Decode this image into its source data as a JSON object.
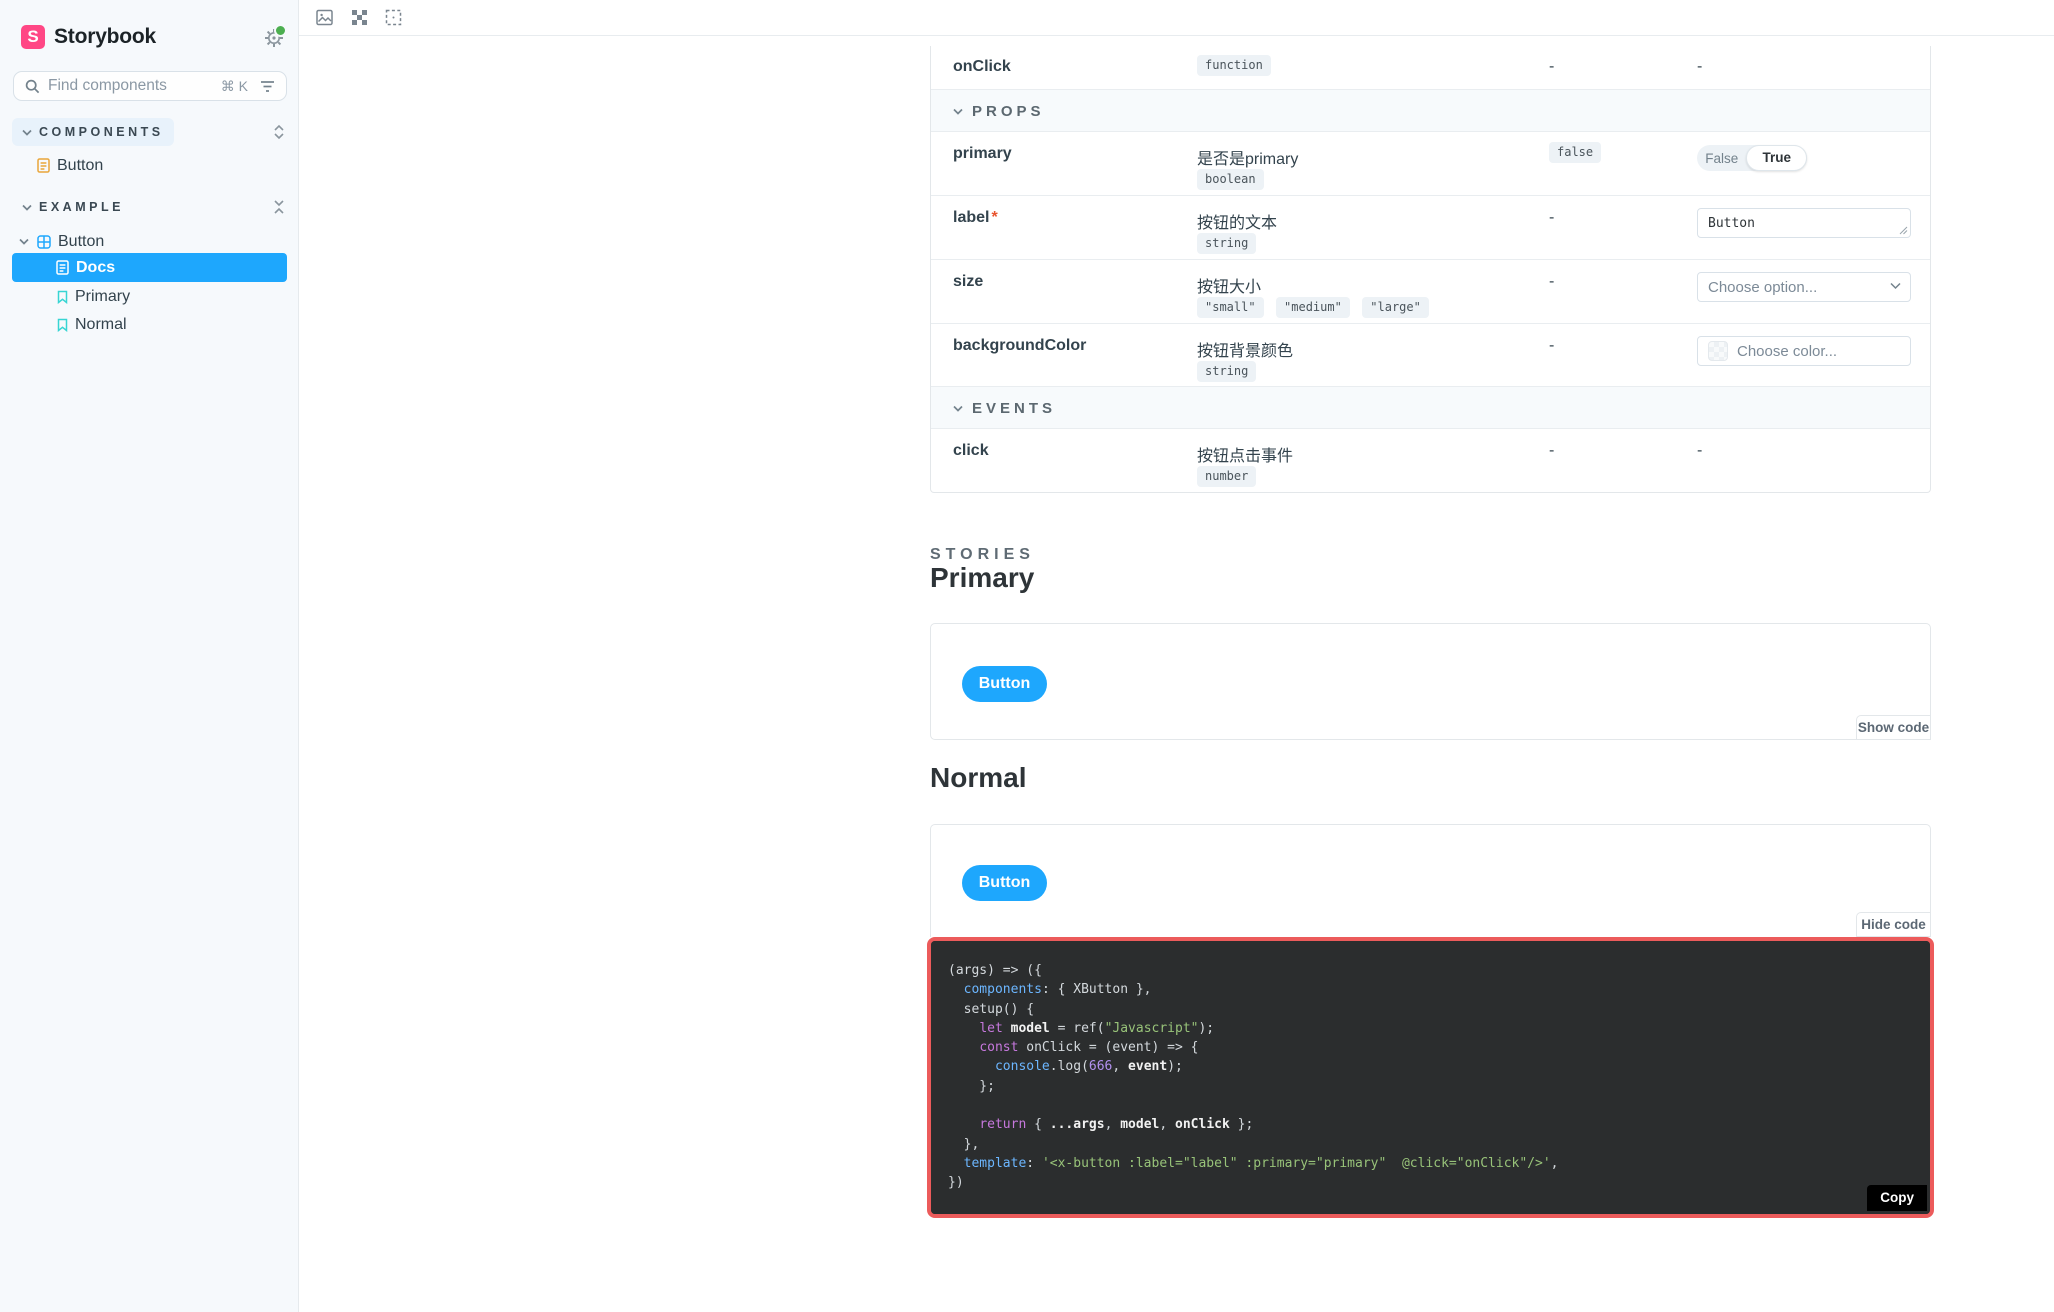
{
  "colors": {
    "accent_blue": "#1EA7FD",
    "brand_pink": "#FF4785",
    "story_icon_teal": "#37D5D3",
    "doc_icon_orange": "#E9A63A",
    "highlight_red_border": "#EC5B5B",
    "code_background": "#2B2D2E",
    "notification_green": "#4CAF50"
  },
  "sidebar": {
    "brand": "Storybook",
    "logo_letter": "S",
    "search": {
      "placeholder": "Find components",
      "shortcut": "⌘ K"
    },
    "components_section": {
      "label": "COMPONENTS",
      "button_item": "Button"
    },
    "example_section": {
      "label": "EXAMPLE",
      "group_label": "Button",
      "docs_item": "Docs",
      "primary_item": "Primary",
      "normal_item": "Normal"
    }
  },
  "args_table": {
    "onclick_row": {
      "name": "onClick",
      "type": "function",
      "default": "-",
      "control": "-"
    },
    "props": {
      "title": "PROPS",
      "rows": [
        {
          "name": "primary",
          "description": "是否是primary",
          "type": "boolean",
          "default": "false",
          "control_off": "False",
          "control_on": "True"
        },
        {
          "name": "label",
          "required_mark": "*",
          "description": "按钮的文本",
          "type": "string",
          "default": "-",
          "control_value": "Button"
        },
        {
          "name": "size",
          "description": "按钮大小",
          "type_options": [
            "\"small\"",
            "\"medium\"",
            "\"large\""
          ],
          "default": "-",
          "control_placeholder": "Choose option..."
        },
        {
          "name": "backgroundColor",
          "description": "按钮背景颜色",
          "type": "string",
          "default": "-",
          "control_placeholder": "Choose color..."
        }
      ]
    },
    "events": {
      "title": "EVENTS",
      "rows": [
        {
          "name": "click",
          "description": "按钮点击事件",
          "type": "number",
          "default": "-",
          "control": "-"
        }
      ]
    }
  },
  "stories": {
    "heading": "STORIES",
    "primary": {
      "title": "Primary",
      "button_label": "Button",
      "code_toggle": "Show code"
    },
    "normal": {
      "title": "Normal",
      "button_label": "Button",
      "code_toggle": "Hide code",
      "copy_label": "Copy"
    }
  },
  "code_block": {
    "lines": [
      [
        {
          "t": "(args) => ({",
          "c": "plain"
        }
      ],
      [
        {
          "t": "  ",
          "c": "plain"
        },
        {
          "t": "components",
          "c": "prop"
        },
        {
          "t": ": { XButton },",
          "c": "plain"
        }
      ],
      [
        {
          "t": "  setup() {",
          "c": "plain"
        }
      ],
      [
        {
          "t": "    ",
          "c": "plain"
        },
        {
          "t": "let",
          "c": "kw"
        },
        {
          "t": " ",
          "c": "plain"
        },
        {
          "t": "model",
          "c": "bold"
        },
        {
          "t": " = ref(",
          "c": "plain"
        },
        {
          "t": "\"Javascript\"",
          "c": "str"
        },
        {
          "t": ");",
          "c": "plain"
        }
      ],
      [
        {
          "t": "    ",
          "c": "plain"
        },
        {
          "t": "const",
          "c": "kw"
        },
        {
          "t": " onClick = (event) => {",
          "c": "plain"
        }
      ],
      [
        {
          "t": "      ",
          "c": "plain"
        },
        {
          "t": "console",
          "c": "prop"
        },
        {
          "t": ".log(",
          "c": "plain"
        },
        {
          "t": "666",
          "c": "num"
        },
        {
          "t": ", ",
          "c": "plain"
        },
        {
          "t": "event",
          "c": "bold"
        },
        {
          "t": ");",
          "c": "plain"
        }
      ],
      [
        {
          "t": "    };",
          "c": "plain"
        }
      ],
      [
        {
          "t": " ",
          "c": "plain"
        }
      ],
      [
        {
          "t": "    ",
          "c": "plain"
        },
        {
          "t": "return",
          "c": "kw"
        },
        {
          "t": " { ",
          "c": "plain"
        },
        {
          "t": "...args",
          "c": "bold"
        },
        {
          "t": ", ",
          "c": "plain"
        },
        {
          "t": "model",
          "c": "bold"
        },
        {
          "t": ", ",
          "c": "plain"
        },
        {
          "t": "onClick",
          "c": "bold"
        },
        {
          "t": " };",
          "c": "plain"
        }
      ],
      [
        {
          "t": "  },",
          "c": "plain"
        }
      ],
      [
        {
          "t": "  ",
          "c": "plain"
        },
        {
          "t": "template",
          "c": "prop"
        },
        {
          "t": ": ",
          "c": "plain"
        },
        {
          "t": "'<x-button :label=\"label\" :primary=\"primary\"  @click=\"onClick\"/>'",
          "c": "str"
        },
        {
          "t": ",",
          "c": "plain"
        }
      ],
      [
        {
          "t": "})",
          "c": "plain"
        }
      ]
    ]
  }
}
